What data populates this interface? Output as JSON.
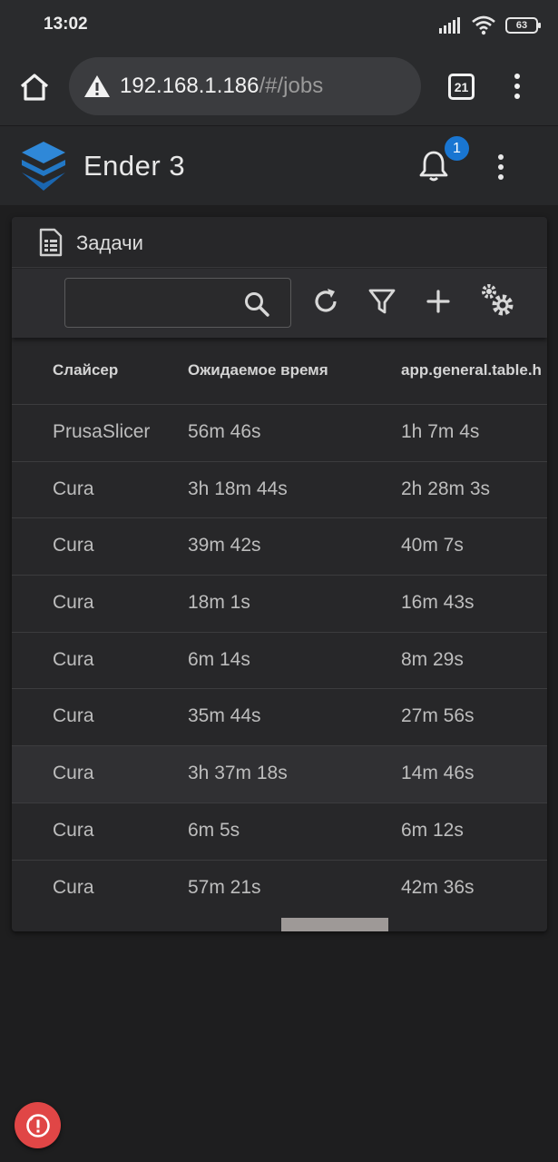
{
  "status_bar": {
    "time": "13:02",
    "battery": "63"
  },
  "browser": {
    "url_host": "192.168.1.186",
    "url_path": "/#/jobs",
    "tab_count": "21"
  },
  "app_bar": {
    "title": "Ender 3",
    "notification_count": "1"
  },
  "card": {
    "title": "Задачи",
    "search": {
      "value": "",
      "placeholder": ""
    },
    "columns": [
      "Слайсер",
      "Ожидаемое время",
      "app.general.table.h"
    ],
    "rows": [
      {
        "slicer": "PrusaSlicer",
        "estimated": "56m 46s",
        "actual": "1h 7m 4s"
      },
      {
        "slicer": "Cura",
        "estimated": "3h 18m 44s",
        "actual": "2h 28m 3s"
      },
      {
        "slicer": "Cura",
        "estimated": "39m 42s",
        "actual": "40m 7s"
      },
      {
        "slicer": "Cura",
        "estimated": "18m 1s",
        "actual": "16m 43s"
      },
      {
        "slicer": "Cura",
        "estimated": "6m 14s",
        "actual": "8m 29s"
      },
      {
        "slicer": "Cura",
        "estimated": "35m 44s",
        "actual": "27m 56s"
      },
      {
        "slicer": "Cura",
        "estimated": "3h 37m 18s",
        "actual": "14m 46s"
      },
      {
        "slicer": "Cura",
        "estimated": "6m 5s",
        "actual": "6m 12s"
      },
      {
        "slicer": "Cura",
        "estimated": "57m 21s",
        "actual": "42m 36s"
      }
    ]
  },
  "colors": {
    "accent": "#1976d2",
    "danger": "#e04646"
  }
}
